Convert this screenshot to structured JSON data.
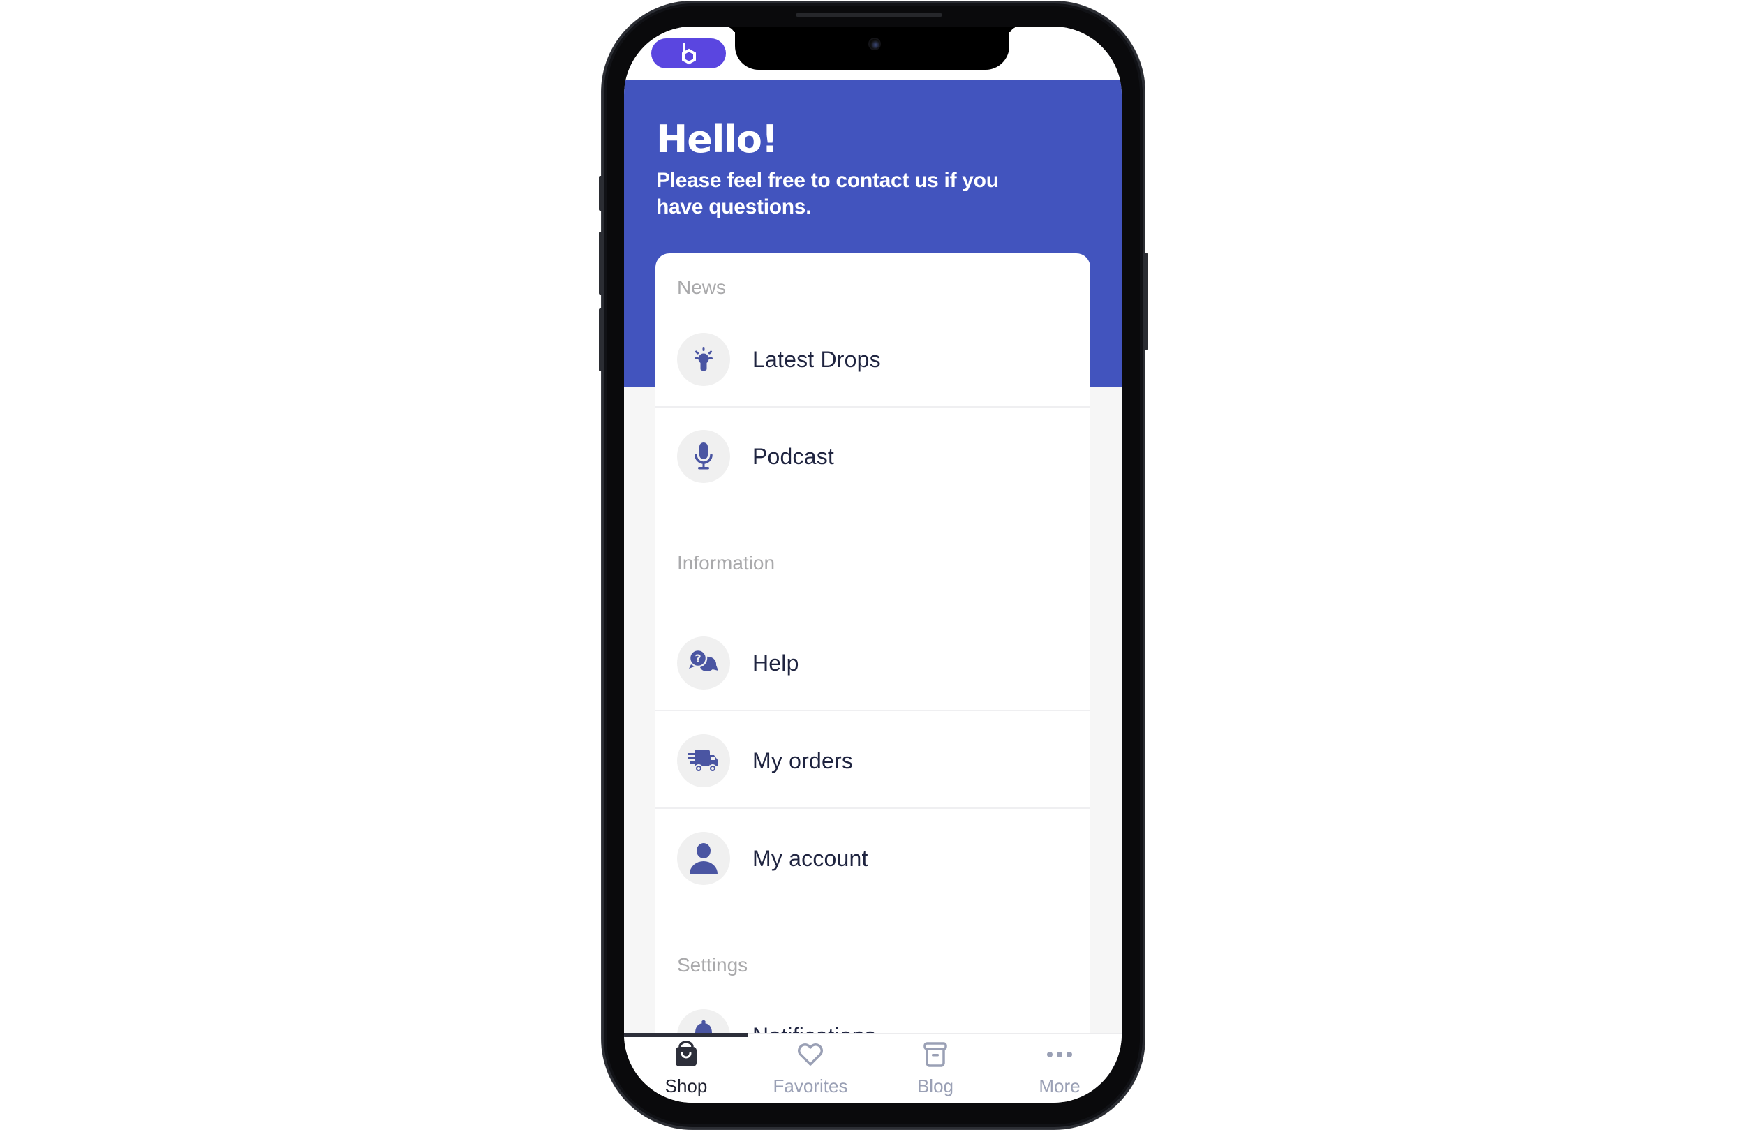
{
  "app": {
    "logo_icon": "hexagon-b-logo",
    "brand_color": "#5a46e0",
    "header_color": "#4254be",
    "icon_color": "#4a55a2"
  },
  "header": {
    "title": "Hello!",
    "subtitle": "Please feel free to contact us if you have questions."
  },
  "sections": [
    {
      "title": "News",
      "items": [
        {
          "label": "Latest Drops",
          "icon": "lightbulb-icon"
        },
        {
          "label": "Podcast",
          "icon": "microphone-icon"
        }
      ]
    },
    {
      "title": "Information",
      "items": [
        {
          "label": "Help",
          "icon": "help-chat-icon"
        },
        {
          "label": "My orders",
          "icon": "delivery-truck-icon"
        },
        {
          "label": "My account",
          "icon": "user-icon"
        }
      ]
    },
    {
      "title": "Settings",
      "items": [
        {
          "label": "Notifications",
          "icon": "bell-icon"
        }
      ]
    }
  ],
  "tabbar": {
    "active": "Shop",
    "tabs": [
      {
        "label": "Shop",
        "icon": "shopping-bag-icon",
        "active": true
      },
      {
        "label": "Favorites",
        "icon": "heart-icon",
        "active": false
      },
      {
        "label": "Blog",
        "icon": "archive-box-icon",
        "active": false
      },
      {
        "label": "More",
        "icon": "more-dots-icon",
        "active": false
      }
    ]
  }
}
